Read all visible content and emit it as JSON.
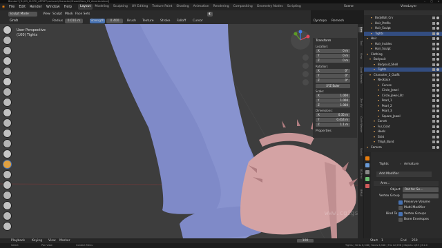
{
  "window": {
    "title": "Blender* [D:\\CG_CLOTH_ARTIST\\Lectures\\Character\\Shoes\\Class_21_Accents.blend]"
  },
  "menubar": {
    "items": [
      "File",
      "Edit",
      "Render",
      "Window",
      "Help"
    ],
    "workspaces": [
      "Layout",
      "Modeling",
      "Sculpting",
      "UV Editing",
      "Texture Paint",
      "Shading",
      "Animation",
      "Rendering",
      "Compositing",
      "Geometry Nodes",
      "Scripting"
    ],
    "active_workspace": "Layout",
    "scene": "Scene",
    "view_layer": "ViewLayer"
  },
  "header3d": {
    "mode": "Sculpt Mode",
    "view": "View",
    "sculpt": "Sculpt",
    "mask": "Mask",
    "face_sets": "Face Sets"
  },
  "toolsettings": {
    "tool": "Grab",
    "radius_label": "Radius",
    "radius_value": "0.016 m",
    "strength_label": "Strength",
    "strength_value": "0.400",
    "brush": "Brush",
    "texture": "Texture",
    "stroke": "Stroke",
    "falloff": "Falloff",
    "cursor": "Cursor",
    "dyntopo": "Dyntopo",
    "remesh": "Remesh"
  },
  "viewport": {
    "perspective": "User Perspective",
    "object": "(100) Tights",
    "watermark": "www.cgigs.com"
  },
  "transform_panel": {
    "title": "Transform",
    "location_label": "Location:",
    "location": [
      [
        "X",
        "0 m"
      ],
      [
        "Y",
        "0 m"
      ],
      [
        "Z",
        "0 m"
      ]
    ],
    "rotation_label": "Rotation:",
    "rotation": [
      [
        "X",
        "0°"
      ],
      [
        "Y",
        "0°"
      ],
      [
        "Z",
        "0°"
      ]
    ],
    "rotation_mode": "XYZ Euler",
    "scale_label": "Scale:",
    "scale": [
      [
        "X",
        "1.000"
      ],
      [
        "Y",
        "1.000"
      ],
      [
        "Z",
        "1.000"
      ]
    ],
    "dimensions_label": "Dimensions:",
    "dimensions": [
      [
        "X",
        "0.35 m"
      ],
      [
        "Y",
        "0.414 m"
      ],
      [
        "Z",
        "1.1 m"
      ]
    ],
    "properties": "Properties"
  },
  "sidetabs": [
    "Item",
    "Tool",
    "View",
    "Quad Remesh",
    "Zen UV",
    "Cloth Weaver",
    "Sculpt",
    "3D-Print",
    "BMAX"
  ],
  "outliner": {
    "rows": [
      {
        "label": "BodyBall_Crv",
        "indent": 10,
        "sel": false
      },
      {
        "label": "Hair_Profile",
        "indent": 10,
        "sel": false
      },
      {
        "label": "Hair_Sculpt",
        "indent": 10,
        "sel": false
      },
      {
        "label": "Tights",
        "indent": 10,
        "sel": true
      },
      {
        "label": "Hair",
        "indent": 4,
        "sel": false
      },
      {
        "label": "Hair_Insides",
        "indent": 10,
        "sel": false
      },
      {
        "label": "Hair_Sculpt",
        "indent": 10,
        "sel": false
      },
      {
        "label": "Clothing",
        "indent": 4,
        "sel": false
      },
      {
        "label": "Bodysuit",
        "indent": 8,
        "sel": false
      },
      {
        "label": "Bodysuit_Shell",
        "indent": 14,
        "sel": false
      },
      {
        "label": "Tights",
        "indent": 14,
        "sel": true
      },
      {
        "label": "Character_2_Outfit",
        "indent": 8,
        "sel": false
      },
      {
        "label": "Necklace",
        "indent": 14,
        "sel": false
      },
      {
        "label": "Curves",
        "indent": 20,
        "sel": false
      },
      {
        "label": "Circle_Jewel",
        "indent": 20,
        "sel": false
      },
      {
        "label": "Circle_Jewel_Str",
        "indent": 20,
        "sel": false
      },
      {
        "label": "Pearl_1",
        "indent": 20,
        "sel": false
      },
      {
        "label": "Pearl_2",
        "indent": 20,
        "sel": false
      },
      {
        "label": "Pearl_3",
        "indent": 20,
        "sel": false
      },
      {
        "label": "Square_Jewel",
        "indent": 20,
        "sel": false
      },
      {
        "label": "Corset",
        "indent": 14,
        "sel": false
      },
      {
        "label": "Fur_Coat",
        "indent": 14,
        "sel": false
      },
      {
        "label": "Heels",
        "indent": 14,
        "sel": false
      },
      {
        "label": "Skirt",
        "indent": 14,
        "sel": false
      },
      {
        "label": "Thigh_Band",
        "indent": 14,
        "sel": false
      },
      {
        "label": "Camera",
        "indent": 4,
        "sel": false
      }
    ]
  },
  "properties": {
    "breadcrumb_object": "Tights",
    "breadcrumb_modifier": "Armature",
    "add_modifier": "Add Modifier",
    "modifier_name": "Arm...",
    "object_label": "Object",
    "object_value": "Rat for Se...",
    "vertex_group_label": "Vertex Group",
    "preserve_volume": "Preserve Volume",
    "multi_modifier": "Multi Modifier",
    "bind_to_label": "Bind To",
    "vertex_groups": "Vertex Groups",
    "bone_envelopes": "Bone Envelopes"
  },
  "timeline": {
    "playback": "Playback",
    "keying": "Keying",
    "view": "View",
    "marker": "Marker",
    "current_frame": "100",
    "start_label": "Start",
    "start": "1",
    "end_label": "End",
    "end": "250"
  },
  "statusbar": {
    "left": "Select",
    "mid": "Pan View",
    "right": "Context Menu",
    "stats": "Tights | Verts 6,348 | Faces 6,348 | Tris 12,596 | Objects 1/33 | 3.2.0"
  },
  "colors": {
    "accent": "#4772b3",
    "skin": "#7f8ac8",
    "shoe": "#d4a3a4",
    "viewport_bg": "#3d3d3d"
  }
}
